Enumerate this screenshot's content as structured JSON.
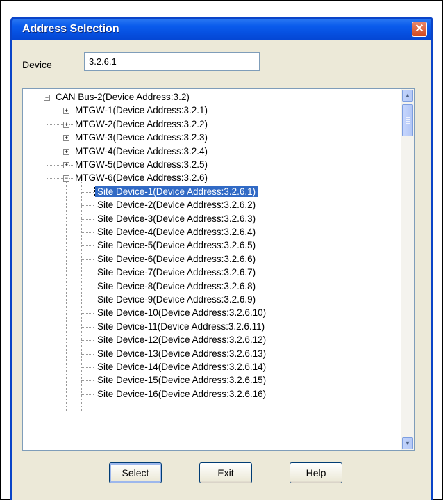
{
  "dialog": {
    "title": "Address Selection",
    "close_glyph": "✕"
  },
  "device": {
    "label": "Device",
    "value": "3.2.6.1"
  },
  "tree": {
    "root": {
      "label": "CAN Bus-2(Device Address:3.2)",
      "expander": "−"
    },
    "gateways": [
      {
        "label": "MTGW-1(Device Address:3.2.1)",
        "expander": "+"
      },
      {
        "label": "MTGW-2(Device Address:3.2.2)",
        "expander": "+"
      },
      {
        "label": "MTGW-3(Device Address:3.2.3)",
        "expander": "+"
      },
      {
        "label": "MTGW-4(Device Address:3.2.4)",
        "expander": "+"
      },
      {
        "label": "MTGW-5(Device Address:3.2.5)",
        "expander": "+"
      },
      {
        "label": "MTGW-6(Device Address:3.2.6)",
        "expander": "−"
      }
    ],
    "sites": [
      "Site Device-1(Device Address:3.2.6.1)",
      "Site Device-2(Device Address:3.2.6.2)",
      "Site Device-3(Device Address:3.2.6.3)",
      "Site Device-4(Device Address:3.2.6.4)",
      "Site Device-5(Device Address:3.2.6.5)",
      "Site Device-6(Device Address:3.2.6.6)",
      "Site Device-7(Device Address:3.2.6.7)",
      "Site Device-8(Device Address:3.2.6.8)",
      "Site Device-9(Device Address:3.2.6.9)",
      "Site Device-10(Device Address:3.2.6.10)",
      "Site Device-11(Device Address:3.2.6.11)",
      "Site Device-12(Device Address:3.2.6.12)",
      "Site Device-13(Device Address:3.2.6.13)",
      "Site Device-14(Device Address:3.2.6.14)",
      "Site Device-15(Device Address:3.2.6.15)",
      "Site Device-16(Device Address:3.2.6.16)"
    ],
    "selected_site_index": 0
  },
  "scrollbar": {
    "up_glyph": "▲",
    "down_glyph": "▼"
  },
  "buttons": {
    "select": "Select",
    "exit": "Exit",
    "help": "Help"
  },
  "colors": {
    "titlebar": "#0a5bec",
    "selection": "#316ac5",
    "face": "#ece9d8"
  }
}
